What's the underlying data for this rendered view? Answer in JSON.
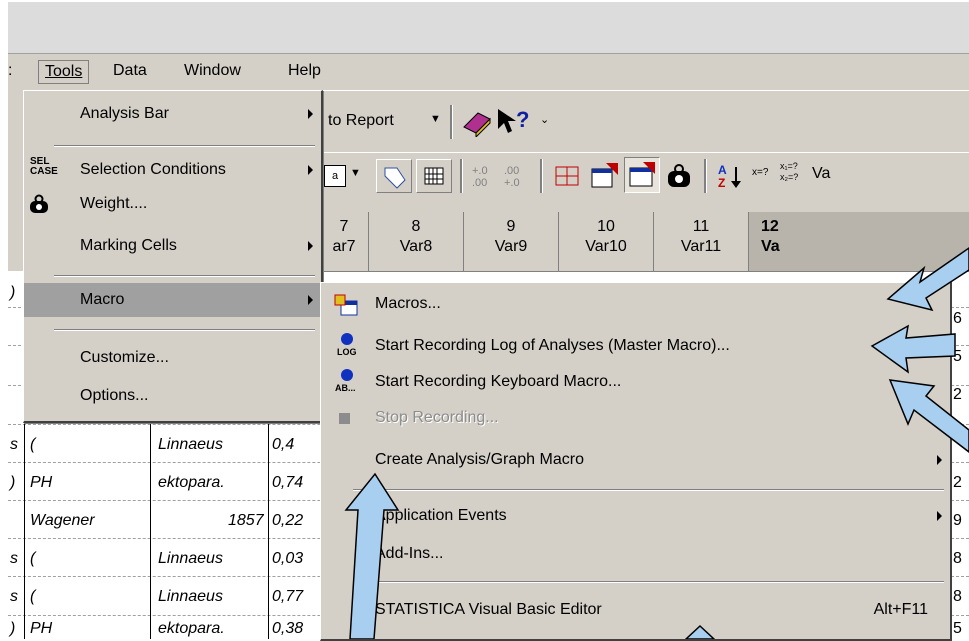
{
  "menubar": {
    "items": [
      "Tools",
      "Data",
      "Window",
      "Help"
    ],
    "left_fragment": ":"
  },
  "toolbar1": {
    "report_label": "l to Report"
  },
  "toolbar2": {
    "var_fragment": "Va"
  },
  "tools_menu": {
    "items": [
      {
        "label": "Analysis Bar",
        "has_submenu": true
      },
      {
        "label": "Selection Conditions",
        "has_submenu": true,
        "icon": "sel-case-icon"
      },
      {
        "label": "Weight....",
        "has_submenu": false,
        "icon": "weight-icon"
      },
      {
        "label": "Marking Cells",
        "has_submenu": true
      },
      {
        "label": "Macro",
        "has_submenu": true,
        "highlighted": true
      },
      {
        "label": "Customize...",
        "has_submenu": false
      },
      {
        "label": "Options...",
        "has_submenu": false
      }
    ]
  },
  "macro_menu": {
    "items": [
      {
        "label": "Macros...",
        "icon": "macros-icon"
      },
      {
        "label": "Start Recording Log of Analyses (Master Macro)...",
        "icon": "record-log-icon",
        "icon_text": "LOG"
      },
      {
        "label": "Start Recording Keyboard Macro...",
        "icon": "record-keyboard-icon",
        "icon_text": "AB..."
      },
      {
        "label": "Stop Recording...",
        "icon": "stop-icon",
        "disabled": true
      },
      {
        "label": "Create Analysis/Graph Macro",
        "has_submenu": true
      },
      {
        "label": "Application Events",
        "has_submenu": true
      },
      {
        "label": "Add-Ins..."
      },
      {
        "label": "STATISTICA Visual Basic Editor",
        "shortcut": "Alt+F11"
      }
    ]
  },
  "grid": {
    "columns": [
      {
        "num": "7",
        "name": "ar7"
      },
      {
        "num": "8",
        "name": "Var8"
      },
      {
        "num": "9",
        "name": "Var9"
      },
      {
        "num": "10",
        "name": "Var10"
      },
      {
        "num": "11",
        "name": "Var11"
      },
      {
        "num": "12",
        "name": "Va"
      }
    ],
    "rows": [
      {
        "c0": "s",
        "c1": "(",
        "c2": "Linnaeus",
        "c3": "0,4"
      },
      {
        "c0": ")",
        "c1": "PH",
        "c2": "ektopara.",
        "c3": "0,74"
      },
      {
        "c0": "",
        "c1": "Wagener",
        "c2": "1857",
        "c3": "0,22"
      },
      {
        "c0": "s",
        "c1": "(",
        "c2": "Linnaeus",
        "c3": "0,03"
      },
      {
        "c0": "s",
        "c1": "(",
        "c2": "Linnaeus",
        "c3": "0,77"
      },
      {
        "c0": ")",
        "c1": "PH",
        "c2": "ektopara.",
        "c3": "0,38"
      }
    ],
    "right_edge_digits": [
      "6",
      "5",
      "2",
      "2",
      "9",
      "8",
      "8",
      "5"
    ],
    "top_row_fragments": [
      "",
      ")"
    ]
  },
  "colors": {
    "menu_bg": "#d4d0c8",
    "highlight_bg": "#a0a0a0",
    "arrow_fill": "#a8cff0",
    "arrow_stroke": "#000000"
  }
}
